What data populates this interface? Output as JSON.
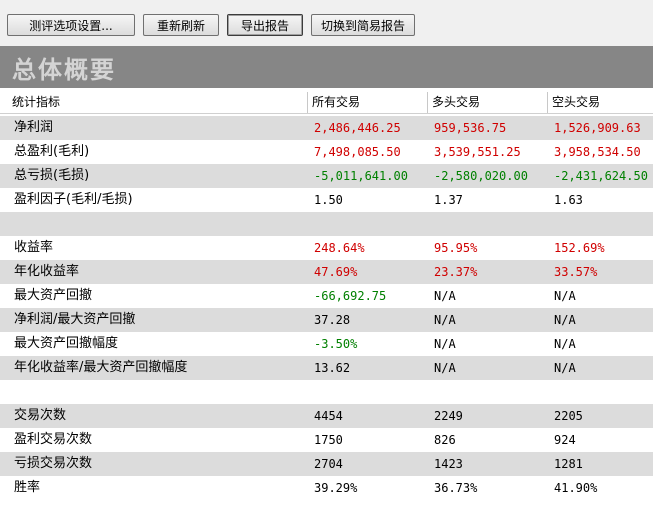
{
  "toolbar": {
    "buttons": [
      {
        "label": "测评选项设置..."
      },
      {
        "label": "重新刷新"
      },
      {
        "label": "导出报告"
      },
      {
        "label": "切换到简易报告"
      }
    ]
  },
  "banner": {
    "title": "总体概要"
  },
  "table": {
    "columns": [
      "统计指标",
      "所有交易",
      "多头交易",
      "空头交易"
    ],
    "rows": [
      {
        "label": "净利润",
        "values": [
          "2,486,446.25",
          "959,536.75",
          "1,526,909.63"
        ],
        "tone": [
          "red",
          "red",
          "red"
        ]
      },
      {
        "label": "总盈利(毛利)",
        "values": [
          "7,498,085.50",
          "3,539,551.25",
          "3,958,534.50"
        ],
        "tone": [
          "red",
          "red",
          "red"
        ]
      },
      {
        "label": "总亏损(毛损)",
        "values": [
          "-5,011,641.00",
          "-2,580,020.00",
          "-2,431,624.50"
        ],
        "tone": [
          "green",
          "green",
          "green"
        ]
      },
      {
        "label": "盈利因子(毛利/毛损)",
        "values": [
          "1.50",
          "1.37",
          "1.63"
        ],
        "tone": [
          "black",
          "black",
          "black"
        ]
      },
      {
        "label": "",
        "values": [
          "",
          "",
          ""
        ],
        "tone": [
          "black",
          "black",
          "black"
        ]
      },
      {
        "label": "收益率",
        "values": [
          "248.64%",
          "95.95%",
          "152.69%"
        ],
        "tone": [
          "red",
          "red",
          "red"
        ]
      },
      {
        "label": "年化收益率",
        "values": [
          "47.69%",
          "23.37%",
          "33.57%"
        ],
        "tone": [
          "red",
          "red",
          "red"
        ]
      },
      {
        "label": "最大资产回撤",
        "values": [
          "-66,692.75",
          "N/A",
          "N/A"
        ],
        "tone": [
          "green",
          "black",
          "black"
        ]
      },
      {
        "label": "净利润/最大资产回撤",
        "values": [
          "37.28",
          "N/A",
          "N/A"
        ],
        "tone": [
          "black",
          "black",
          "black"
        ]
      },
      {
        "label": "最大资产回撤幅度",
        "values": [
          "-3.50%",
          "N/A",
          "N/A"
        ],
        "tone": [
          "green",
          "black",
          "black"
        ]
      },
      {
        "label": "年化收益率/最大资产回撤幅度",
        "values": [
          "13.62",
          "N/A",
          "N/A"
        ],
        "tone": [
          "black",
          "black",
          "black"
        ]
      },
      {
        "label": "",
        "values": [
          "",
          "",
          ""
        ],
        "tone": [
          "black",
          "black",
          "black"
        ]
      },
      {
        "label": "交易次数",
        "values": [
          "4454",
          "2249",
          "2205"
        ],
        "tone": [
          "black",
          "black",
          "black"
        ]
      },
      {
        "label": "盈利交易次数",
        "values": [
          "1750",
          "826",
          "924"
        ],
        "tone": [
          "black",
          "black",
          "black"
        ]
      },
      {
        "label": "亏损交易次数",
        "values": [
          "2704",
          "1423",
          "1281"
        ],
        "tone": [
          "black",
          "black",
          "black"
        ]
      },
      {
        "label": "胜率",
        "values": [
          "39.29%",
          "36.73%",
          "41.90%"
        ],
        "tone": [
          "black",
          "black",
          "black"
        ]
      }
    ]
  }
}
